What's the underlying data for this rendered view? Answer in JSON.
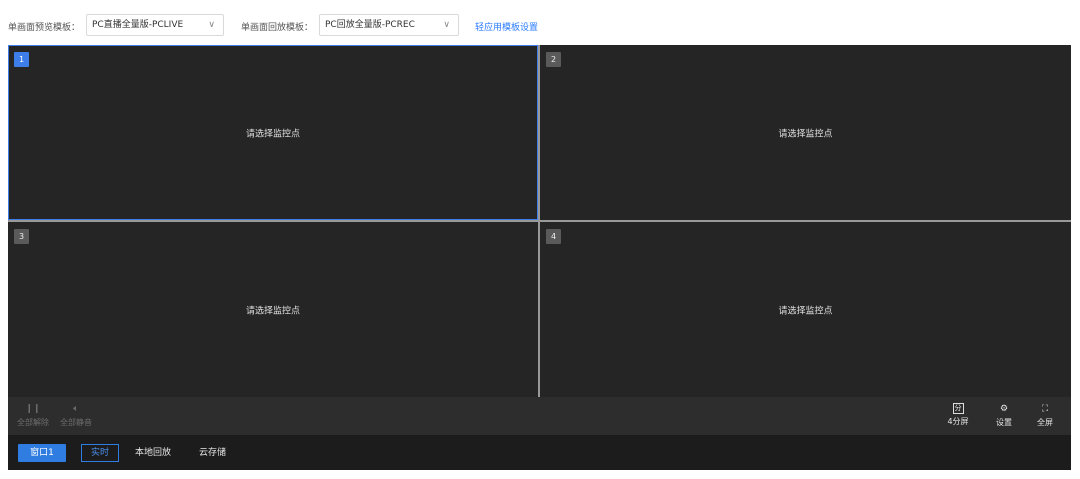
{
  "toolbar": {
    "preview_label": "单画面预览模板：",
    "preview_value": "PC直播全量版-PCLIVE",
    "playback_label": "单画面回放模板：",
    "playback_value": "PC回放全量版-PCREC",
    "apply_link": "轻应用模板设置",
    "chevron": "∨"
  },
  "cells": [
    {
      "index": "1",
      "message": "请选择监控点",
      "active": true
    },
    {
      "index": "2",
      "message": "请选择监控点",
      "active": false
    },
    {
      "index": "3",
      "message": "请选择监控点",
      "active": false
    },
    {
      "index": "4",
      "message": "请选择监控点",
      "active": false
    }
  ],
  "controls": {
    "unmute_all": {
      "label": "全部解除",
      "icon": "pause-icon",
      "glyph": "❙❙"
    },
    "mute_all": {
      "label": "全部静音",
      "icon": "speaker-icon",
      "glyph": "🔈︎"
    },
    "split": {
      "label": "4分屏",
      "icon": "split-screen-icon",
      "glyph": "分"
    },
    "settings": {
      "label": "设置",
      "icon": "gear-icon",
      "glyph": "⚙"
    },
    "fullscreen": {
      "label": "全屏",
      "icon": "fullscreen-icon",
      "glyph": "⛶"
    }
  },
  "tabs": {
    "window": "窗口1",
    "realtime": "实时",
    "local_playback": "本地回放",
    "cloud_storage": "云存储"
  },
  "colors": {
    "accent": "#2f7de1",
    "cell_bg": "#252525",
    "ctrl_bg": "#2d2d2d",
    "tab_bg": "#1c1c1c"
  }
}
